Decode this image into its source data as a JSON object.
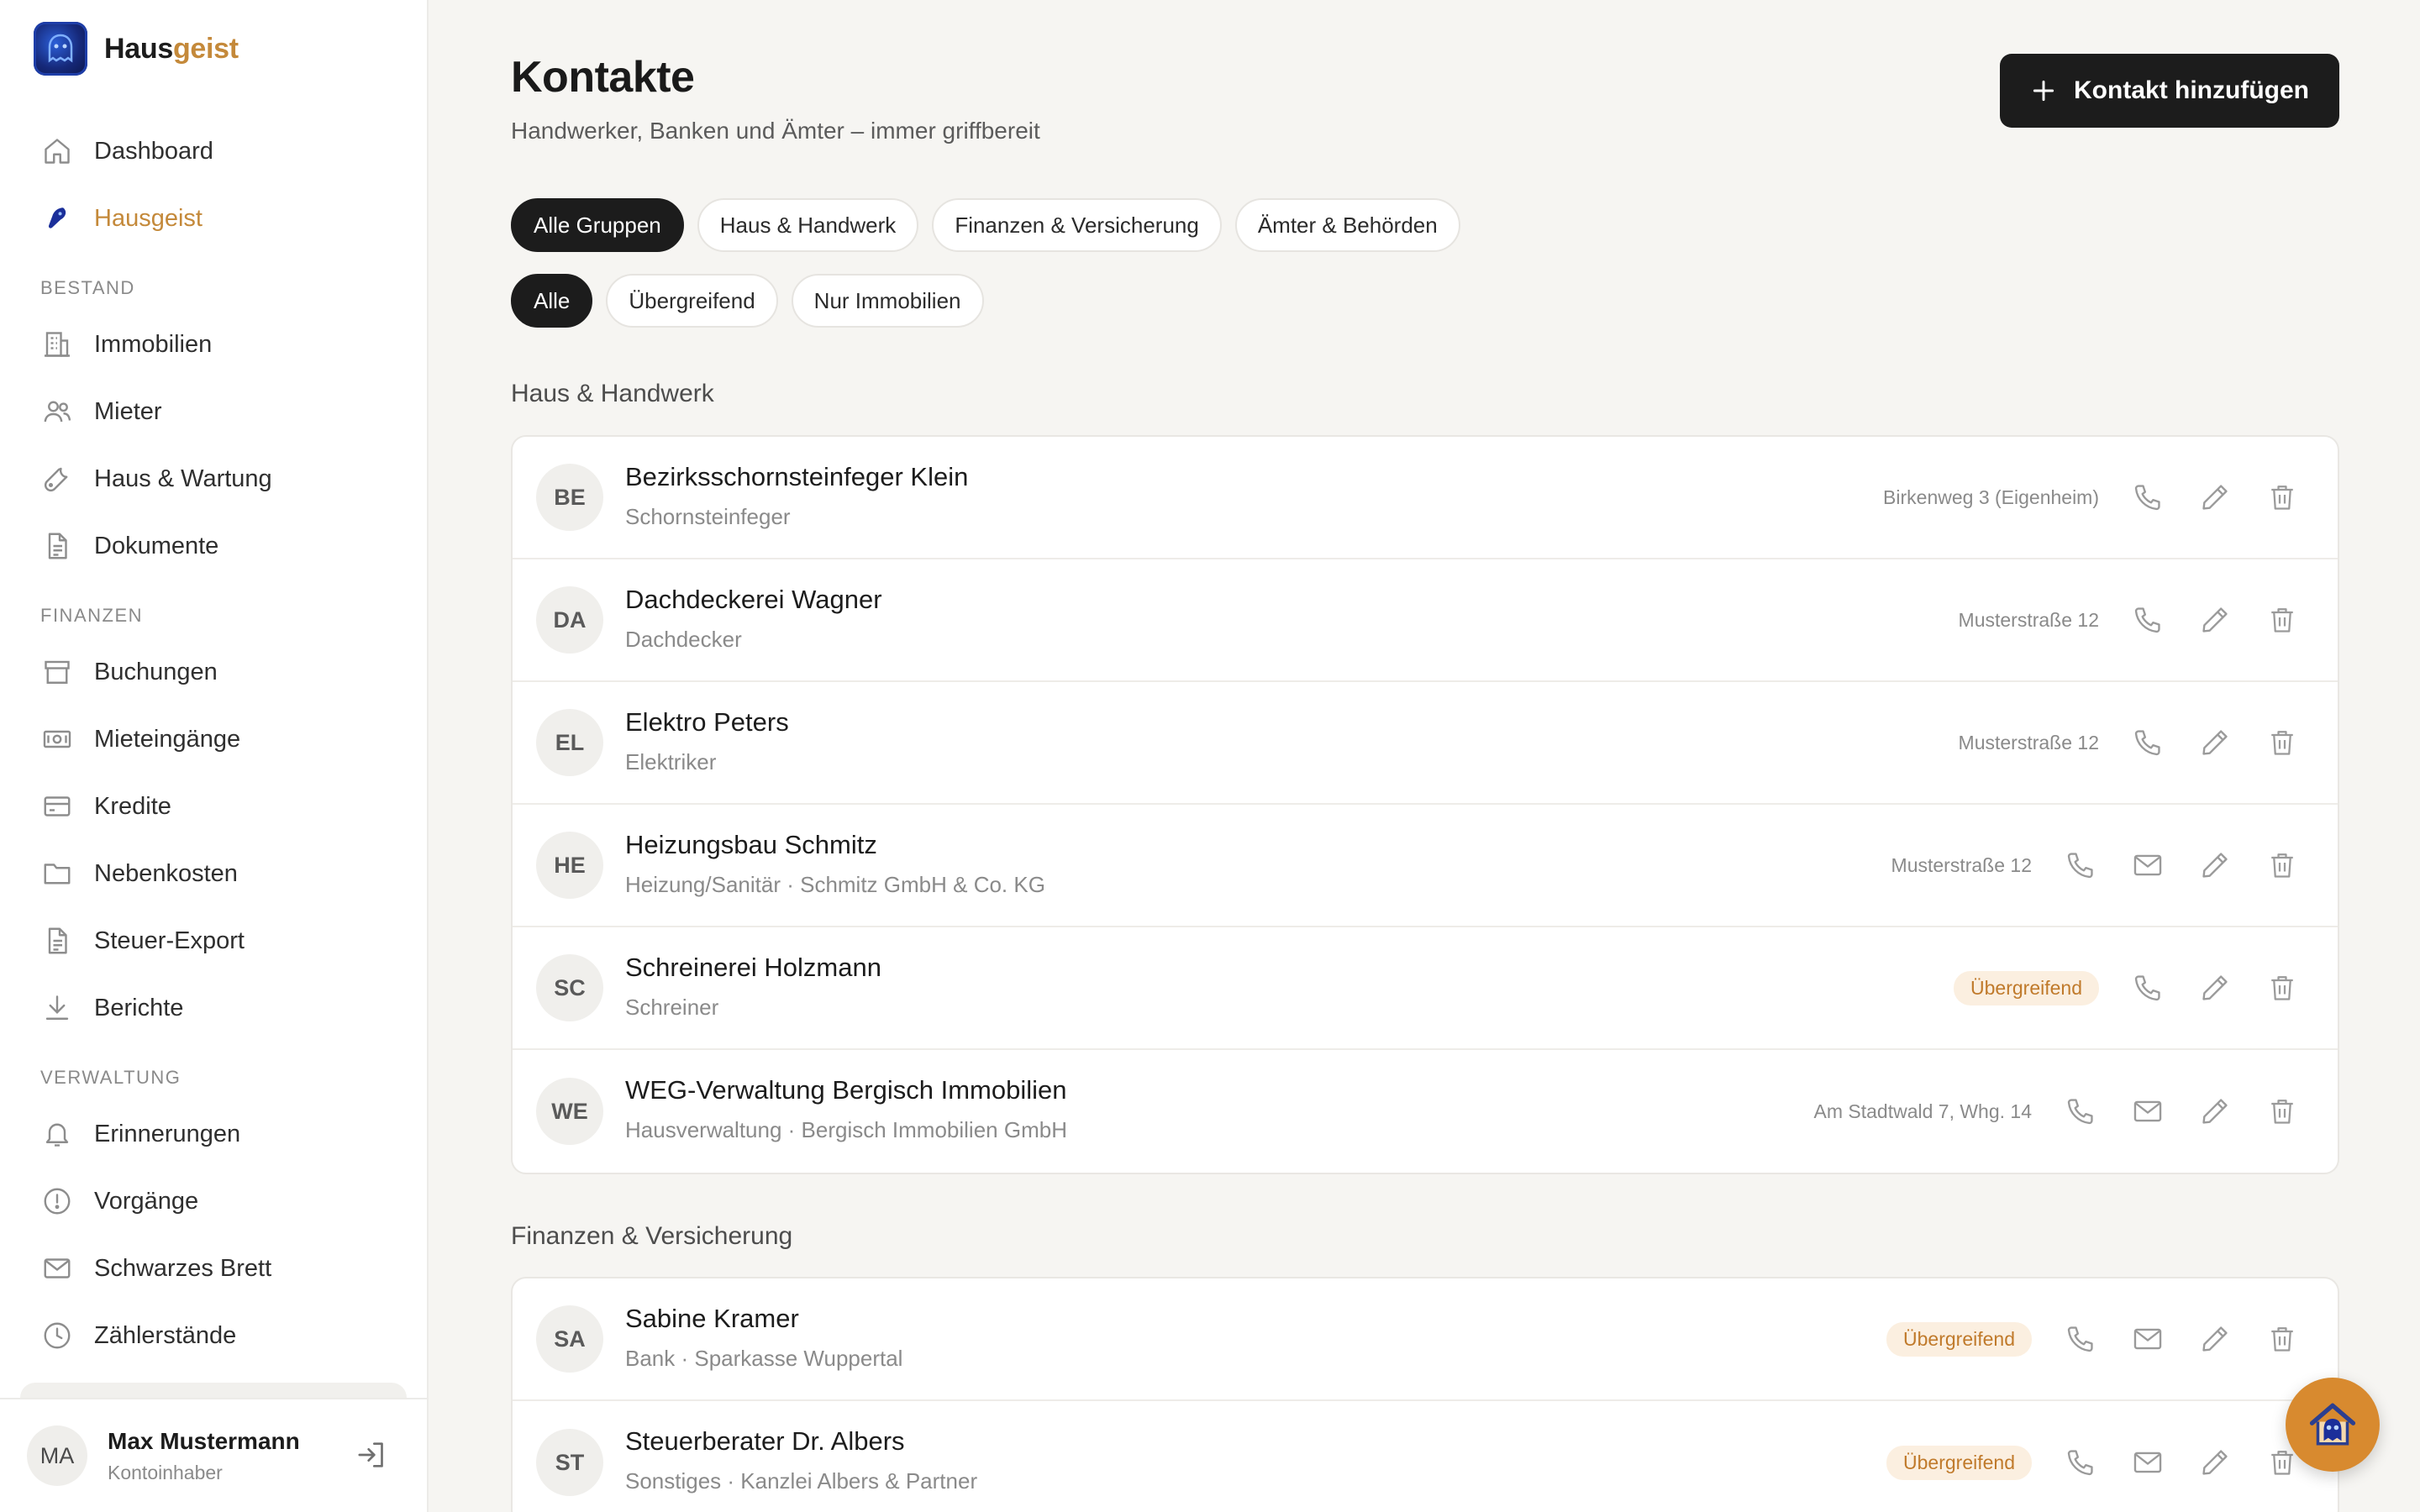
{
  "brand": {
    "name_main": "Haus",
    "name_accent": "geist",
    "accent_color": "#c4893a"
  },
  "sidebar": {
    "top_items": [
      {
        "label": "Dashboard",
        "icon": "home-icon"
      },
      {
        "label": "Hausgeist",
        "icon": "ghost-icon",
        "active": true
      }
    ],
    "sections": [
      {
        "title": "BESTAND",
        "items": [
          {
            "label": "Immobilien",
            "icon": "building-icon"
          },
          {
            "label": "Mieter",
            "icon": "users-icon"
          },
          {
            "label": "Haus & Wartung",
            "icon": "wrench-icon"
          },
          {
            "label": "Dokumente",
            "icon": "document-icon"
          }
        ]
      },
      {
        "title": "FINANZEN",
        "items": [
          {
            "label": "Buchungen",
            "icon": "box-icon"
          },
          {
            "label": "Mieteingänge",
            "icon": "banknote-icon"
          },
          {
            "label": "Kredite",
            "icon": "credit-card-icon"
          },
          {
            "label": "Nebenkosten",
            "icon": "folder-icon"
          },
          {
            "label": "Steuer-Export",
            "icon": "file-icon"
          },
          {
            "label": "Berichte",
            "icon": "download-icon"
          }
        ]
      },
      {
        "title": "VERWALTUNG",
        "items": [
          {
            "label": "Erinnerungen",
            "icon": "bell-icon"
          },
          {
            "label": "Vorgänge",
            "icon": "alert-circle-icon"
          },
          {
            "label": "Schwarzes Brett",
            "icon": "mail-icon"
          },
          {
            "label": "Zählerstände",
            "icon": "clock-icon"
          }
        ]
      }
    ]
  },
  "user": {
    "initials": "MA",
    "name": "Max Mustermann",
    "role": "Kontoinhaber"
  },
  "page": {
    "title": "Kontakte",
    "subtitle": "Handwerker, Banken und Ämter – immer griffbereit",
    "add_button_label": "Kontakt hinzufügen"
  },
  "group_filters": [
    "Alle Gruppen",
    "Haus & Handwerk",
    "Finanzen & Versicherung",
    "Ämter & Behörden"
  ],
  "scope_filters": [
    "Alle",
    "Übergreifend",
    "Nur Immobilien"
  ],
  "groups": [
    {
      "title": "Haus & Handwerk",
      "contacts": [
        {
          "initials": "BE",
          "name": "Bezirksschornsteinfeger Klein",
          "subtitle": "Schornsteinfeger",
          "property": "Birkenweg 3 (Eigenheim)",
          "badge": "",
          "has_phone": true,
          "has_email": false
        },
        {
          "initials": "DA",
          "name": "Dachdeckerei Wagner",
          "subtitle": "Dachdecker",
          "property": "Musterstraße 12",
          "badge": "",
          "has_phone": true,
          "has_email": false
        },
        {
          "initials": "EL",
          "name": "Elektro Peters",
          "subtitle": "Elektriker",
          "property": "Musterstraße 12",
          "badge": "",
          "has_phone": true,
          "has_email": false
        },
        {
          "initials": "HE",
          "name": "Heizungsbau Schmitz",
          "subtitle": "Heizung/Sanitär · Schmitz GmbH & Co. KG",
          "property": "Musterstraße 12",
          "badge": "",
          "has_phone": true,
          "has_email": true
        },
        {
          "initials": "SC",
          "name": "Schreinerei Holzmann",
          "subtitle": "Schreiner",
          "property": "",
          "badge": "Übergreifend",
          "has_phone": true,
          "has_email": false
        },
        {
          "initials": "WE",
          "name": "WEG-Verwaltung Bergisch Immobilien",
          "subtitle": "Hausverwaltung · Bergisch Immobilien GmbH",
          "property": "Am Stadtwald 7, Whg. 14",
          "badge": "",
          "has_phone": true,
          "has_email": true
        }
      ]
    },
    {
      "title": "Finanzen & Versicherung",
      "contacts": [
        {
          "initials": "SA",
          "name": "Sabine Kramer",
          "subtitle": "Bank · Sparkasse Wuppertal",
          "property": "",
          "badge": "Übergreifend",
          "has_phone": true,
          "has_email": true
        },
        {
          "initials": "ST",
          "name": "Steuerberater Dr. Albers",
          "subtitle": "Sonstiges · Kanzlei Albers & Partner",
          "property": "",
          "badge": "Übergreifend",
          "has_phone": true,
          "has_email": true
        }
      ]
    }
  ]
}
